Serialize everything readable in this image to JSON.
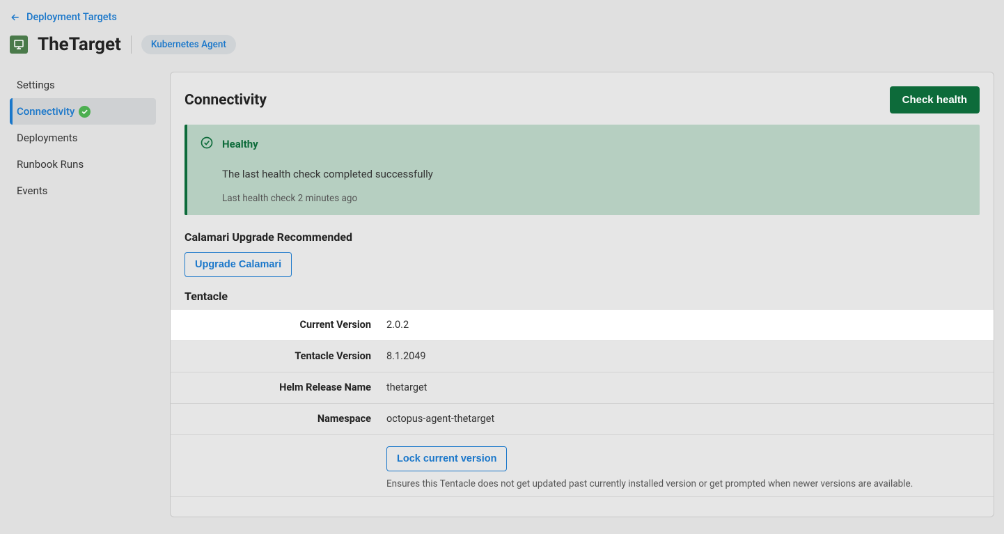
{
  "breadcrumb": {
    "back_label": "Deployment Targets"
  },
  "header": {
    "title": "TheTarget",
    "badge": "Kubernetes Agent"
  },
  "sidebar": {
    "items": [
      {
        "label": "Settings"
      },
      {
        "label": "Connectivity"
      },
      {
        "label": "Deployments"
      },
      {
        "label": "Runbook Runs"
      },
      {
        "label": "Events"
      }
    ]
  },
  "panel": {
    "title": "Connectivity",
    "check_health_label": "Check health",
    "health": {
      "status": "Healthy",
      "description": "The last health check completed successfully",
      "timestamp": "Last health check 2 minutes ago"
    },
    "calamari": {
      "heading": "Calamari Upgrade Recommended",
      "upgrade_label": "Upgrade Calamari"
    },
    "tentacle": {
      "heading": "Tentacle",
      "rows": [
        {
          "label": "Current Version",
          "value": "2.0.2"
        },
        {
          "label": "Tentacle Version",
          "value": "8.1.2049"
        },
        {
          "label": "Helm Release Name",
          "value": "thetarget"
        },
        {
          "label": "Namespace",
          "value": "octopus-agent-thetarget"
        }
      ],
      "lock_label": "Lock current version",
      "lock_desc": "Ensures this Tentacle does not get updated past currently installed version or get prompted when newer versions are available."
    }
  }
}
